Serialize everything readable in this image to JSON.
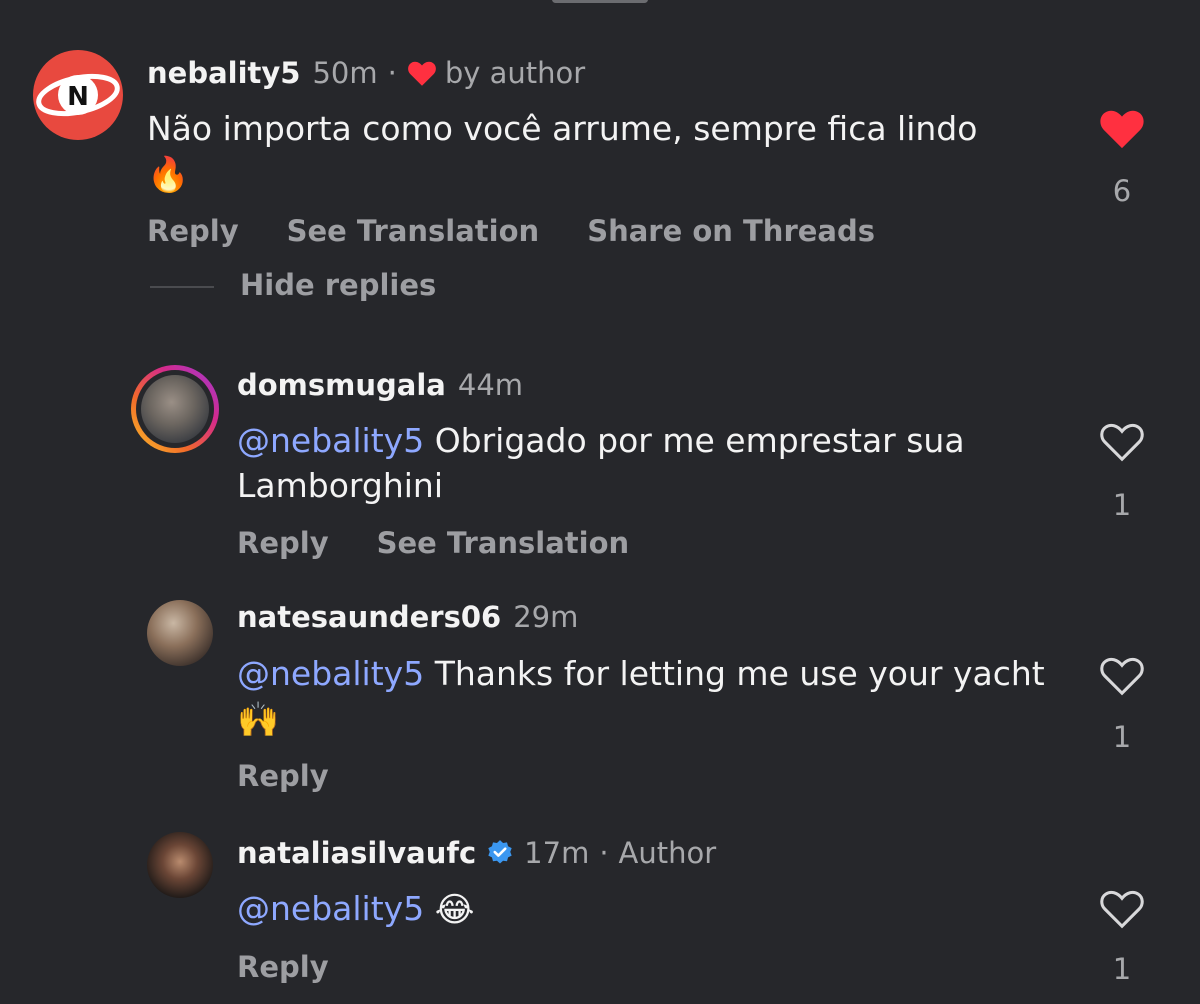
{
  "comments": [
    {
      "username": "nebality5",
      "time": "50m",
      "separator": "·",
      "liked_by_author_label": "by author",
      "text": "Não importa como você arrume, sempre fica lindo",
      "emoji": "🔥",
      "actions": [
        "Reply",
        "See Translation",
        "Share on Threads"
      ],
      "likes": "6",
      "liked": true
    }
  ],
  "hide_replies_label": "Hide replies",
  "replies": [
    {
      "username": "domsmugala",
      "time": "44m",
      "mention": "@nebality5",
      "text": " Obrigado por me emprestar sua Lamborghini",
      "actions": [
        "Reply",
        "See Translation"
      ],
      "likes": "1",
      "liked": false
    },
    {
      "username": "natesaunders06",
      "time": "29m",
      "mention": "@nebality5",
      "text": " Thanks for letting me use your yacht",
      "emoji": "🙌",
      "actions": [
        "Reply"
      ],
      "likes": "1",
      "liked": false
    },
    {
      "username": "nataliasilvaufc",
      "time": "17m",
      "separator": "·",
      "author_label": "Author",
      "verified": true,
      "mention": "@nebality5",
      "emoji": "😂",
      "actions": [
        "Reply"
      ],
      "likes": "1",
      "liked": false
    }
  ],
  "colors": {
    "background": "#26272b",
    "heart_red": "#ff3040",
    "mention_blue": "#8ea8ff",
    "verified_blue": "#3b97f0"
  }
}
